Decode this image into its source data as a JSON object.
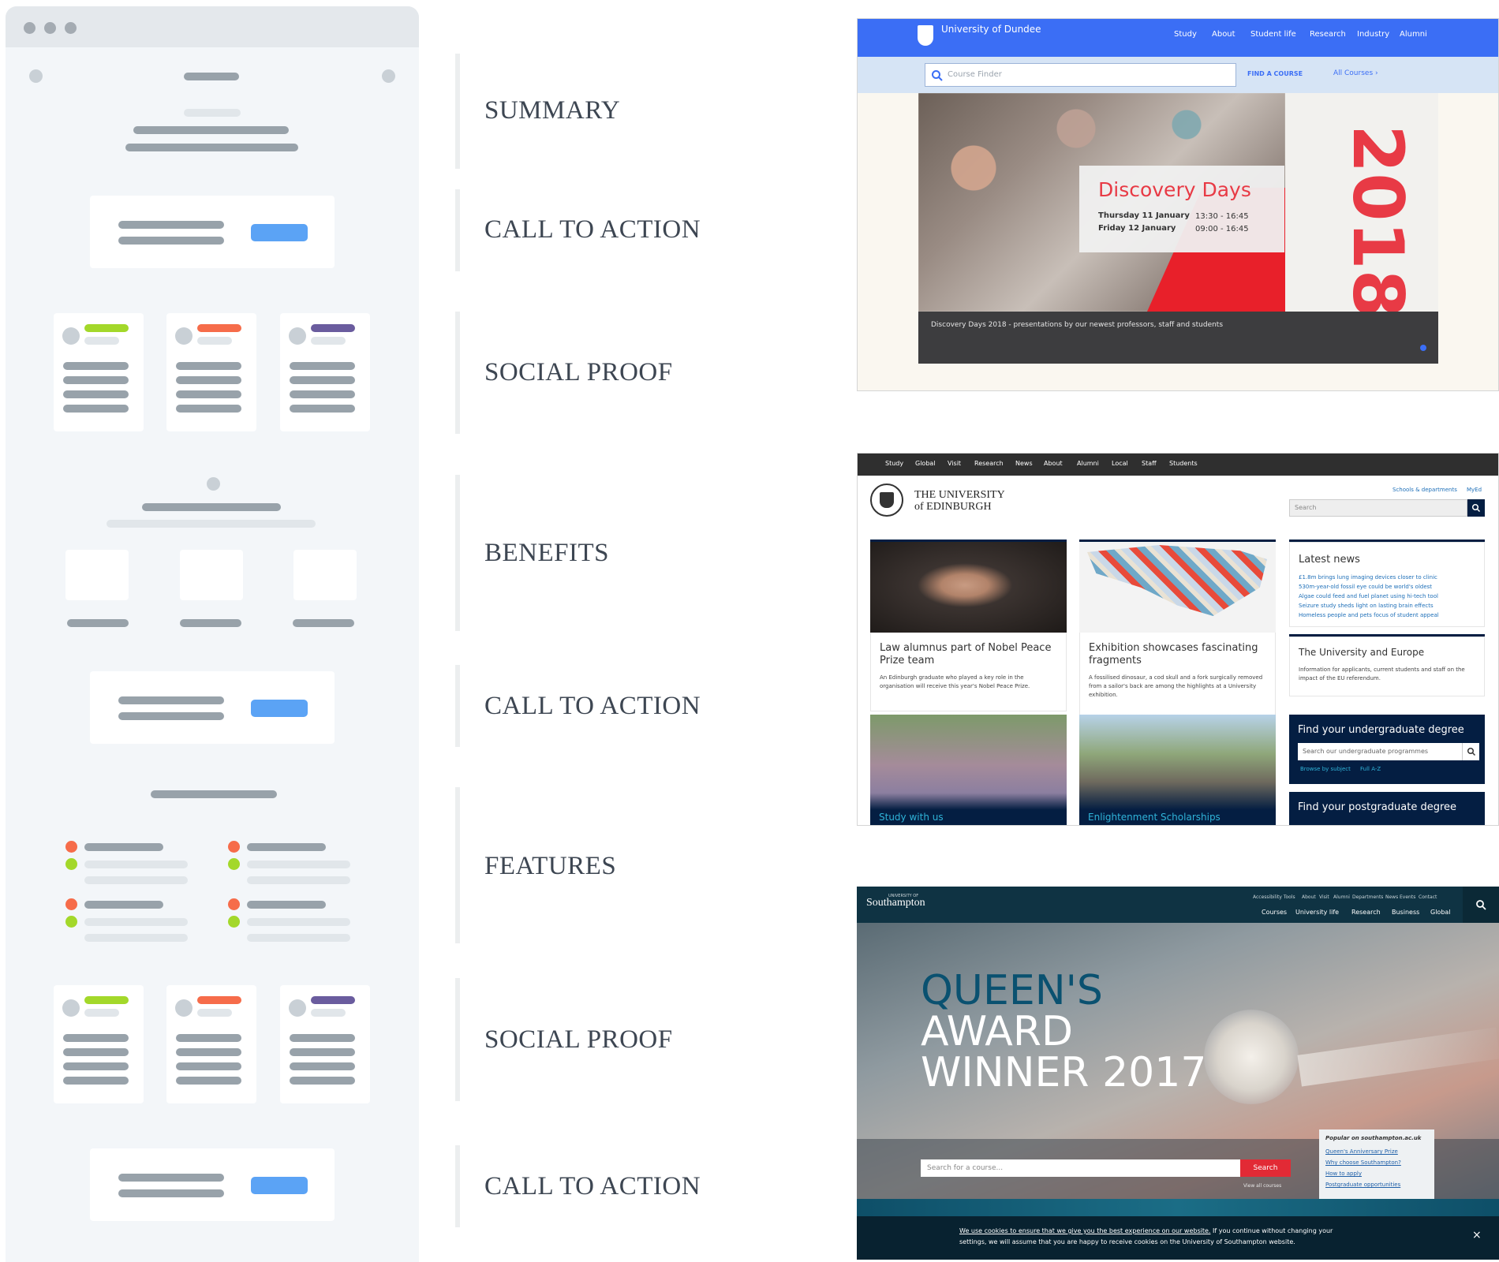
{
  "sections": [
    {
      "label": "SUMMARY"
    },
    {
      "label": "CALL TO ACTION"
    },
    {
      "label": "SOCIAL PROOF"
    },
    {
      "label": "BENEFITS"
    },
    {
      "label": "CALL TO ACTION"
    },
    {
      "label": "FEATURES"
    },
    {
      "label": "SOCIAL PROOF"
    },
    {
      "label": "CALL TO ACTION"
    }
  ],
  "dundee": {
    "brand": "University of Dundee",
    "nav": [
      "Study",
      "About",
      "Student life",
      "Research",
      "Industry",
      "Alumni"
    ],
    "search_placeholder": "Course Finder",
    "find_button": "FIND A COURSE",
    "all_courses": "All Courses ›",
    "banner_title": "Discovery Days",
    "date1": "Thursday 11 January",
    "time1": "13:30 - 16:45",
    "date2": "Friday 12 January",
    "time2": "09:00 - 16:45",
    "year": "2018",
    "caption": "Discovery Days 2018 - presentations by our newest professors, staff and students",
    "colors": {
      "header": "#3b6ef5",
      "accent": "#e83a45"
    }
  },
  "edinburgh": {
    "topnav": [
      "Study",
      "Global",
      "Visit",
      "Research",
      "News",
      "About",
      "Alumni",
      "Local",
      "Staff",
      "Students"
    ],
    "brand_line1": "THE UNIVERSITY",
    "brand_line2": "of EDINBURGH",
    "schools_link": "Schools & departments",
    "myed_link": "MyEd",
    "search_placeholder": "Search",
    "story1_title": "Law alumnus part of Nobel Peace Prize team",
    "story1_text": "An Edinburgh graduate who played a key role in the organisation will receive this year's Nobel Peace Prize.",
    "story2_title": "Exhibition showcases fascinating fragments",
    "story2_text": "A fossilised dinosaur, a cod skull and a fork surgically removed from a sailor's back are among the highlights at a University exhibition.",
    "news_title": "Latest news",
    "news_items": [
      "£1.8m brings lung imaging devices closer to clinic",
      "530m-year-old fossil eye could be world's oldest",
      "Algae could feed and fuel planet using hi-tech tool",
      "Seizure study sheds light on lasting brain effects",
      "Homeless people and pets focus of student appeal"
    ],
    "europe_title": "The University and Europe",
    "europe_text": "Information for applicants, current students and staff on the impact of the EU referendum.",
    "tile1": "Study with us",
    "tile2": "Enlightenment Scholarships",
    "ug_title": "Find your undergraduate degree",
    "ug_placeholder": "Search our undergraduate programmes",
    "ug_link1": "Browse by subject",
    "ug_link2": "Full A-Z",
    "pg_title": "Find your postgraduate degree"
  },
  "southampton": {
    "brand_small": "UNIVERSITY OF",
    "brand": "Southampton",
    "utility_nav": [
      "Accessibility Tools",
      "About",
      "Visit",
      "Alumni",
      "Departments",
      "News",
      "Events",
      "Contact"
    ],
    "main_nav": [
      "Courses",
      "University life",
      "Research",
      "Business",
      "Global"
    ],
    "hero_line1": "QUEEN'S",
    "hero_line2": "AWARD",
    "hero_line3": "WINNER 2017",
    "search_placeholder": "Search for a course...",
    "search_button": "Search",
    "view_all": "View all courses",
    "popular_title": "Popular on southampton.ac.uk",
    "popular_links": [
      "Queen's Anniversary Prize",
      "Why choose Southampton?",
      "How to apply",
      "Postgraduate opportunities"
    ],
    "cookie_link": "We use cookies to ensure that we give you the best experience on our website.",
    "cookie_text1": " If you continue without changing your",
    "cookie_text2": "settings, we will assume that you are happy to receive cookies on the University of Southampton website.",
    "close": "×"
  }
}
